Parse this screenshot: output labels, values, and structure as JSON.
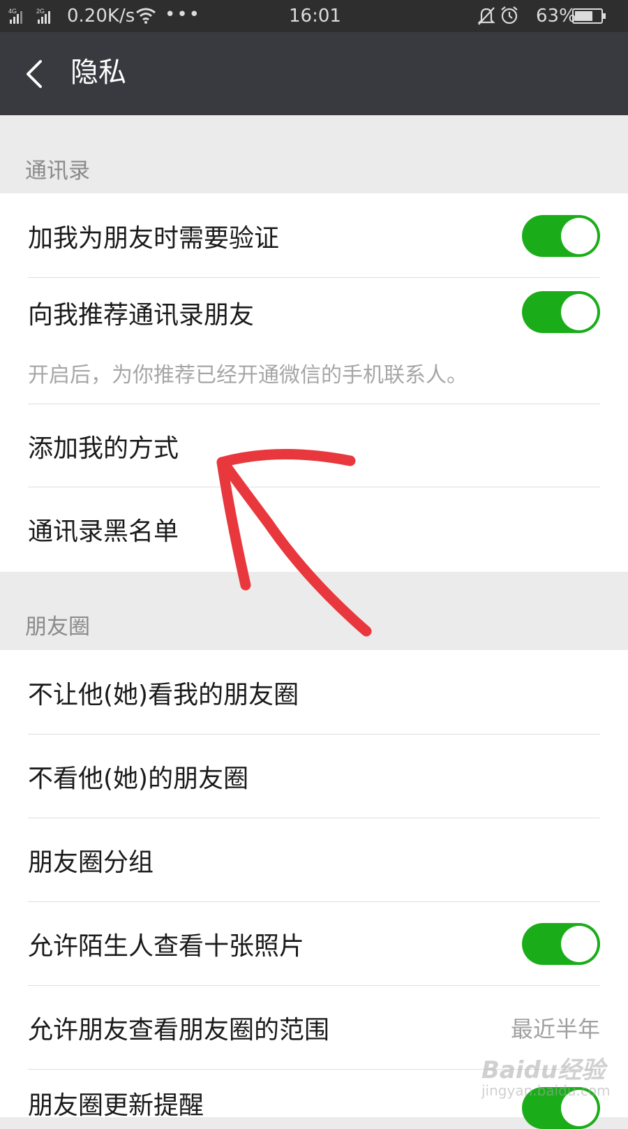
{
  "status_bar": {
    "signal_1": "4G",
    "signal_2": "2G",
    "speed": "0.20K/s",
    "more": "•••",
    "time": "16:01",
    "battery": "63%",
    "icons": [
      "signal-icon",
      "wifi-icon",
      "bell-off-icon",
      "alarm-icon",
      "battery-icon"
    ]
  },
  "nav": {
    "back_icon": "chevron-left-icon",
    "title": "隐私"
  },
  "sections": {
    "contacts": {
      "header": "通讯录",
      "items": {
        "verify": {
          "label": "加我为朋友时需要验证",
          "toggle_on": true
        },
        "recommend": {
          "label": "向我推荐通讯录朋友",
          "toggle_on": true,
          "hint": "开启后，为你推荐已经开通微信的手机联系人。"
        },
        "add_methods": {
          "label": "添加我的方式"
        },
        "blacklist": {
          "label": "通讯录黑名单"
        }
      }
    },
    "moments": {
      "header": "朋友圈",
      "items": {
        "block_them": {
          "label": "不让他(她)看我的朋友圈"
        },
        "hide_theirs": {
          "label": "不看他(她)的朋友圈"
        },
        "groups": {
          "label": "朋友圈分组"
        },
        "strangers": {
          "label": "允许陌生人查看十张照片",
          "toggle_on": true
        },
        "range": {
          "label": "允许朋友查看朋友圈的范围",
          "value": "最近半年"
        },
        "update_remind": {
          "label": "朋友圈更新提醒",
          "toggle_on": true
        }
      }
    }
  },
  "annotation": {
    "type": "red-arrow",
    "color": "#e8383d",
    "points_to": "添加我的方式"
  },
  "watermark": {
    "line1": "Baidu经验",
    "line2": "jingyan.baidu.com"
  },
  "colors": {
    "toggle_on": "#1aad19",
    "nav_bg": "#393a3f",
    "page_bg": "#ebebeb"
  }
}
